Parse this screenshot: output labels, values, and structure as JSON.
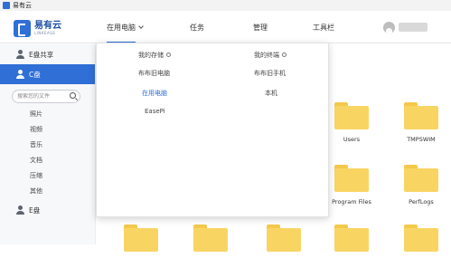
{
  "window": {
    "title": "易有云"
  },
  "brand": {
    "name": "易有云",
    "subtitle": "LINKEASE"
  },
  "nav": {
    "tabs": [
      {
        "label": "在用电脑"
      },
      {
        "label": "任务"
      },
      {
        "label": "管理"
      },
      {
        "label": "工具栏"
      }
    ]
  },
  "sidebar": {
    "items": [
      {
        "label": "E盘共享"
      },
      {
        "label": "C盘"
      },
      {
        "label": "E盘"
      }
    ],
    "search_placeholder": "搜索您的文件",
    "categories": [
      "照片",
      "视频",
      "音乐",
      "文档",
      "压缩",
      "其他"
    ]
  },
  "dropdown": {
    "left_header": "我的存储",
    "right_header": "我的终端",
    "left_items": [
      "布布旧电脑",
      "在用电脑",
      "EasePi"
    ],
    "right_items": [
      "布布旧手机",
      "本机"
    ],
    "active_item": "在用电脑"
  },
  "files": [
    {
      "name": ""
    },
    {
      "name": ""
    },
    {
      "name": "Users"
    },
    {
      "name": "TMPSWIM"
    },
    {
      "name": "Program Files"
    },
    {
      "name": "PerfLogs"
    },
    {
      "name": ""
    },
    {
      "name": ""
    },
    {
      "name": ""
    },
    {
      "name": ""
    },
    {
      "name": ""
    }
  ],
  "colors": {
    "accent": "#2f6fd6",
    "folder": "#f8d563",
    "sidebar_bg": "#f7f8fa"
  }
}
